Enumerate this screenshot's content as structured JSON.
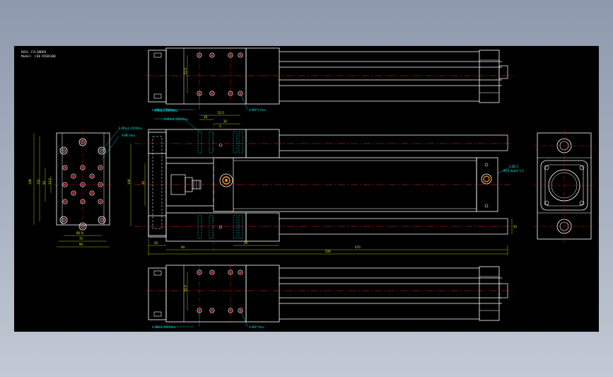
{
  "title_block": {
    "line1": "RAIL CYLINDER",
    "line2": "Model: C48 R50X300"
  },
  "callouts": {
    "top_left": "4-M6x1 25P/thru",
    "top_right": "4-M6*1 thru",
    "mid_a": "4-M5x1 25P/thru",
    "mid_b": "4-M5x1 25P/thru",
    "left_a": "4-M5x1 25P/thru",
    "left_b": "4-Ø6 thru",
    "right_a": "2-Ø5.5",
    "right_b": "Ø10 depth 5.5",
    "bottom_left": "4-M6x1 25P/thru",
    "bottom_right": "4-M6* thru"
  },
  "dimensions": {
    "top_v": "52.5",
    "mid_h1": "52.5",
    "mid_h2": "16",
    "mid_h3": "32",
    "mid_h4": "3",
    "left_w1": "66 %",
    "left_w2": "75",
    "left_w3": "90",
    "left_v1": "148",
    "left_v2": "152",
    "left_v3": "50",
    "left_v4": "33.5",
    "side_v1": "108",
    "side_v2": "40",
    "base_1": "20",
    "base_2": "94",
    "base_3": "26",
    "base_4": "470",
    "base_5": "526",
    "right_v": "45",
    "bot_v": "52.5"
  }
}
